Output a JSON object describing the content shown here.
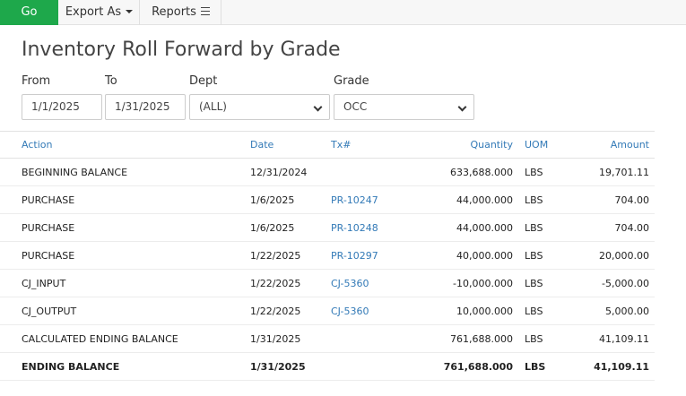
{
  "toolbar": {
    "go_label": "Go",
    "export_label": "Export As",
    "reports_label": "Reports"
  },
  "page_title": "Inventory Roll Forward by Grade",
  "filters": {
    "from_label": "From",
    "from_value": "1/1/2025",
    "to_label": "To",
    "to_value": "1/31/2025",
    "dept_label": "Dept",
    "dept_value": "(ALL)",
    "grade_label": "Grade",
    "grade_value": "OCC"
  },
  "table": {
    "headers": {
      "action": "Action",
      "date": "Date",
      "tx": "Tx#",
      "quantity": "Quantity",
      "uom": "UOM",
      "amount": "Amount"
    },
    "rows": [
      {
        "action": "BEGINNING BALANCE",
        "date": "12/31/2024",
        "tx": "",
        "quantity": "633,688.000",
        "uom": "LBS",
        "amount": "19,701.11"
      },
      {
        "action": "PURCHASE",
        "date": "1/6/2025",
        "tx": "PR-10247",
        "quantity": "44,000.000",
        "uom": "LBS",
        "amount": "704.00"
      },
      {
        "action": "PURCHASE",
        "date": "1/6/2025",
        "tx": "PR-10248",
        "quantity": "44,000.000",
        "uom": "LBS",
        "amount": "704.00"
      },
      {
        "action": "PURCHASE",
        "date": "1/22/2025",
        "tx": "PR-10297",
        "quantity": "40,000.000",
        "uom": "LBS",
        "amount": "20,000.00"
      },
      {
        "action": "CJ_INPUT",
        "date": "1/22/2025",
        "tx": "CJ-5360",
        "quantity": "-10,000.000",
        "uom": "LBS",
        "amount": "-5,000.00"
      },
      {
        "action": "CJ_OUTPUT",
        "date": "1/22/2025",
        "tx": "CJ-5360",
        "quantity": "10,000.000",
        "uom": "LBS",
        "amount": "5,000.00"
      },
      {
        "action": "CALCULATED ENDING BALANCE",
        "date": "1/31/2025",
        "tx": "",
        "quantity": "761,688.000",
        "uom": "LBS",
        "amount": "41,109.11"
      },
      {
        "action": "ENDING BALANCE",
        "date": "1/31/2025",
        "tx": "",
        "quantity": "761,688.000",
        "uom": "LBS",
        "amount": "41,109.11"
      }
    ]
  },
  "colors": {
    "go_button": "#1ea84b",
    "link": "#337ab7"
  }
}
